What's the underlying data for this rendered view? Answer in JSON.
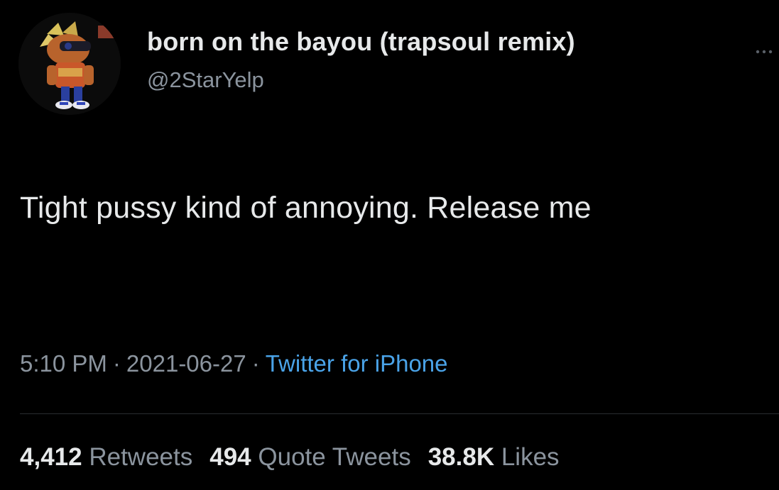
{
  "user": {
    "display_name": "born on the bayou (trapsoul remix)",
    "handle": "@2StarYelp",
    "avatar_icon": "cartoon-character-avatar"
  },
  "tweet": {
    "text": "Tight pussy kind of annoying. Release me",
    "time": "5:10 PM",
    "date": "2021-06-27",
    "source": "Twitter for iPhone"
  },
  "stats": {
    "retweets_count": "4,412",
    "retweets_label": "Retweets",
    "quotes_count": "494",
    "quotes_label": "Quote Tweets",
    "likes_count": "38.8K",
    "likes_label": "Likes"
  },
  "colors": {
    "background": "#000000",
    "text_primary": "#e7e9ea",
    "text_secondary": "#8b949e",
    "link": "#4aa3e8"
  }
}
